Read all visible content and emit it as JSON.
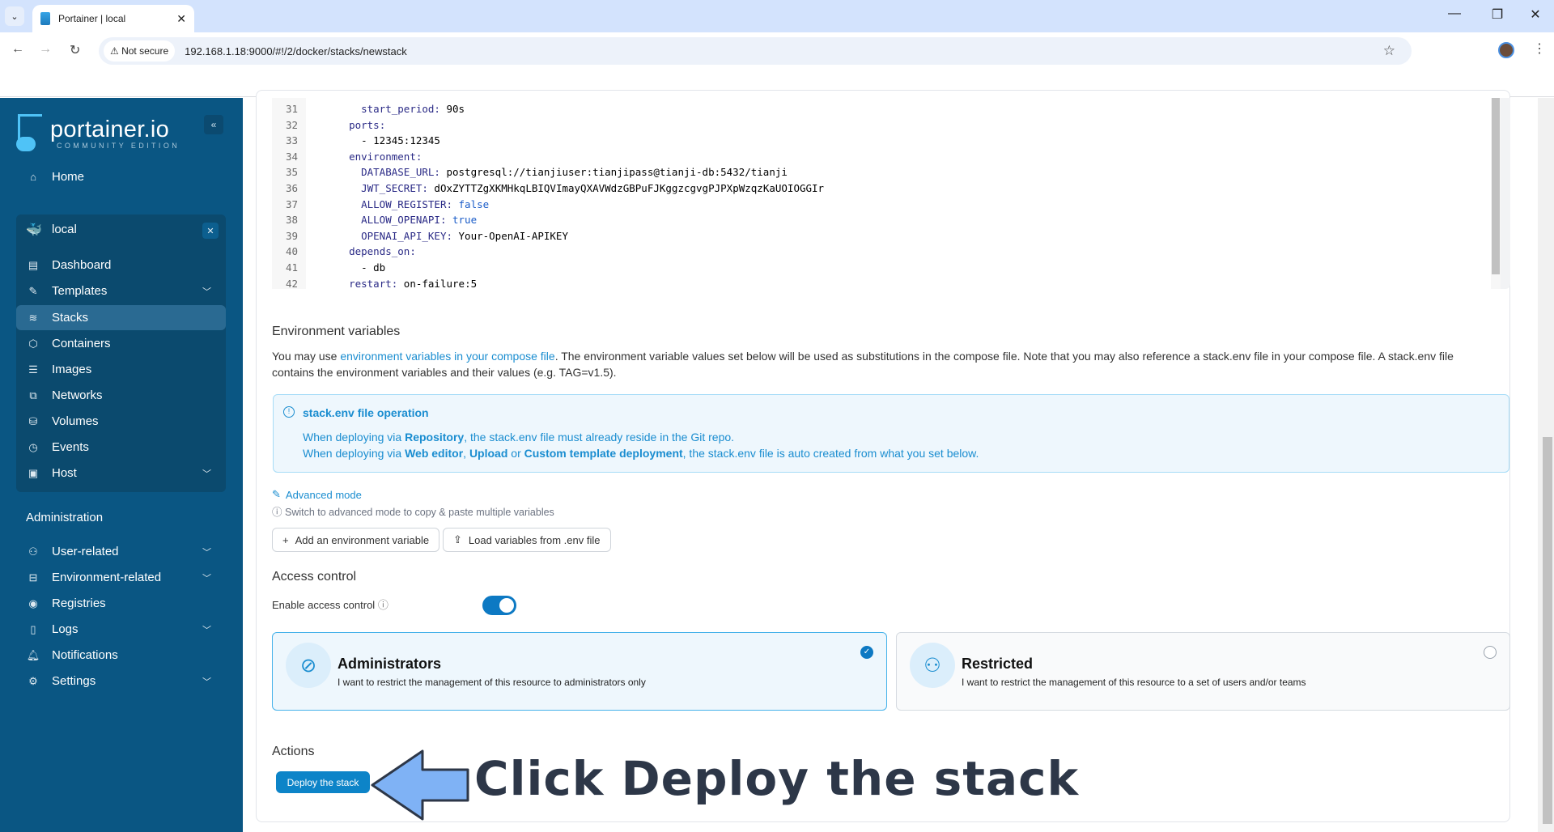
{
  "browser": {
    "tab_title": "Portainer | local",
    "not_secure_label": "Not secure",
    "url": "192.168.1.18:9000/#!/2/docker/stacks/newstack"
  },
  "sidebar": {
    "brand": "portainer.io",
    "brand_sub": "COMMUNITY EDITION",
    "home": "Home",
    "environment": "local",
    "env_items": [
      {
        "label": "Dashboard",
        "icon": "dashboard-icon"
      },
      {
        "label": "Templates",
        "icon": "edit-icon",
        "expandable": true
      },
      {
        "label": "Stacks",
        "icon": "layers-icon",
        "active": true
      },
      {
        "label": "Containers",
        "icon": "box-icon"
      },
      {
        "label": "Images",
        "icon": "list-icon"
      },
      {
        "label": "Networks",
        "icon": "network-icon"
      },
      {
        "label": "Volumes",
        "icon": "database-icon"
      },
      {
        "label": "Events",
        "icon": "clock-icon"
      },
      {
        "label": "Host",
        "icon": "host-icon",
        "expandable": true
      }
    ],
    "admin_heading": "Administration",
    "admin_items": [
      {
        "label": "User-related",
        "icon": "users-icon",
        "expandable": true
      },
      {
        "label": "Environment-related",
        "icon": "drive-icon",
        "expandable": true
      },
      {
        "label": "Registries",
        "icon": "radio-icon"
      },
      {
        "label": "Logs",
        "icon": "file-icon",
        "expandable": true
      },
      {
        "label": "Notifications",
        "icon": "bell-icon"
      },
      {
        "label": "Settings",
        "icon": "gear-icon",
        "expandable": true
      }
    ]
  },
  "editor": {
    "lines": [
      {
        "n": "31",
        "indent": "    ",
        "key": "start_period",
        "val": " 90s",
        "vclass": ""
      },
      {
        "n": "32",
        "indent": "  ",
        "key": "ports",
        "val": "",
        "vclass": ""
      },
      {
        "n": "33",
        "indent": "    ",
        "key": "",
        "val": "- 12345:12345",
        "vclass": ""
      },
      {
        "n": "34",
        "indent": "  ",
        "key": "environment",
        "val": "",
        "vclass": ""
      },
      {
        "n": "35",
        "indent": "    ",
        "key": "DATABASE_URL",
        "val": " postgresql://tianjiuser:tianjipass@tianji-db:5432/tianji",
        "vclass": ""
      },
      {
        "n": "36",
        "indent": "    ",
        "key": "JWT_SECRET",
        "val": " dOxZYTTZgXKMHkqLBIQVImayQXAVWdzGBPuFJKggzcgvgPJPXpWzqzKaUOIOGGIr",
        "vclass": ""
      },
      {
        "n": "37",
        "indent": "    ",
        "key": "ALLOW_REGISTER",
        "val": " false",
        "vclass": "b"
      },
      {
        "n": "38",
        "indent": "    ",
        "key": "ALLOW_OPENAPI",
        "val": " true",
        "vclass": "b"
      },
      {
        "n": "39",
        "indent": "    ",
        "key": "OPENAI_API_KEY",
        "val": " Your-OpenAI-APIKEY",
        "vclass": ""
      },
      {
        "n": "40",
        "indent": "  ",
        "key": "depends_on",
        "val": "",
        "vclass": ""
      },
      {
        "n": "41",
        "indent": "    ",
        "key": "",
        "val": "- db",
        "vclass": ""
      },
      {
        "n": "42",
        "indent": "  ",
        "key": "restart",
        "val": " on-failure:5",
        "vclass": ""
      }
    ]
  },
  "env_vars": {
    "title": "Environment variables",
    "desc_prefix": "You may use ",
    "desc_link": "environment variables in your compose file",
    "desc_suffix": ". The environment variable values set below will be used as substitutions in the compose file. Note that you may also reference a stack.env file in your compose file. A stack.env file contains the environment variables and their values (e.g. TAG=v1.5).",
    "info_title": "stack.env file operation",
    "info_line1_a": "When deploying via ",
    "info_line1_b": "Repository",
    "info_line1_c": ", the stack.env file must already reside in the Git repo.",
    "info_line2_a": "When deploying via ",
    "info_line2_b": "Web editor",
    "info_line2_c": ", ",
    "info_line2_d": "Upload",
    "info_line2_e": " or ",
    "info_line2_f": "Custom template deployment",
    "info_line2_g": ", the stack.env file is auto created from what you set below.",
    "advanced_mode": "Advanced mode",
    "advanced_hint": "Switch to advanced mode to copy & paste multiple variables",
    "add_button": "Add an environment variable",
    "load_button": "Load variables from .env file"
  },
  "access_control": {
    "title": "Access control",
    "toggle_label": "Enable access control",
    "enabled": true,
    "options": [
      {
        "title": "Administrators",
        "desc": "I want to restrict the management of this resource to administrators only",
        "selected": true
      },
      {
        "title": "Restricted",
        "desc": "I want to restrict the management of this resource to a set of users and/or teams",
        "selected": false
      }
    ]
  },
  "actions": {
    "title": "Actions",
    "deploy_button": "Deploy the stack"
  },
  "annotation": {
    "callout": "Click Deploy the stack"
  }
}
